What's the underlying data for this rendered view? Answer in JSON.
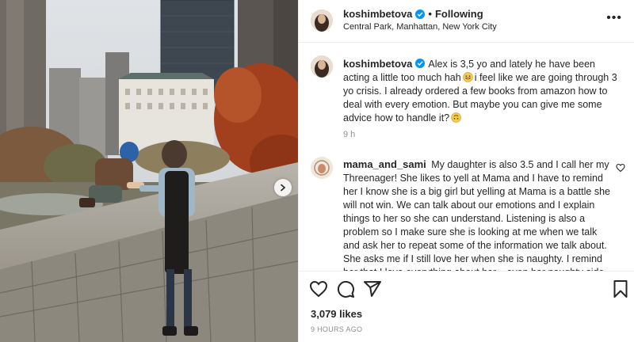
{
  "post": {
    "username": "koshimbetova",
    "follow_state": "Following",
    "separator": "•",
    "location": "Central Park, Manhattan, New York City",
    "more_label": "•••"
  },
  "caption": {
    "username": "koshimbetova",
    "text_part1": "Alex is 3,5 yo and lately he have been acting a little too much hah",
    "text_part2": "i feel like we are going through 3 yo crisis. I already ordered a few books from amazon how to deal with every emotion. But maybe you can give me some advice how to handle it?",
    "time": "9 h"
  },
  "comment": {
    "username": "mama_and_sami",
    "text": "My daughter is also 3.5 and I call her my Threenager! She likes to yell at Mama and I have to remind her I know she is a big girl but yelling at Mama is a battle she will not win. We can talk about our emotions and I explain things to her so she can understand. Listening is also a problem so I make sure she is looking at me when we talk and ask her to repeat some of the information we talk about. She asks me if I still love her when she is naughty. I remind her that I love everything about her... even her naughty side... I just like her"
  },
  "engagement": {
    "likes": "3,079 likes",
    "time_ago": "9 HOURS AGO"
  },
  "icons": {
    "like": "heart-icon",
    "comment": "comment-icon",
    "share": "send-icon",
    "save": "bookmark-icon",
    "verified": "verified-badge-icon",
    "next": "chevron-right-icon"
  },
  "colors": {
    "verified": "#0095f6",
    "muted": "#8e8e8e",
    "text": "#262626",
    "divider": "#efefef"
  }
}
